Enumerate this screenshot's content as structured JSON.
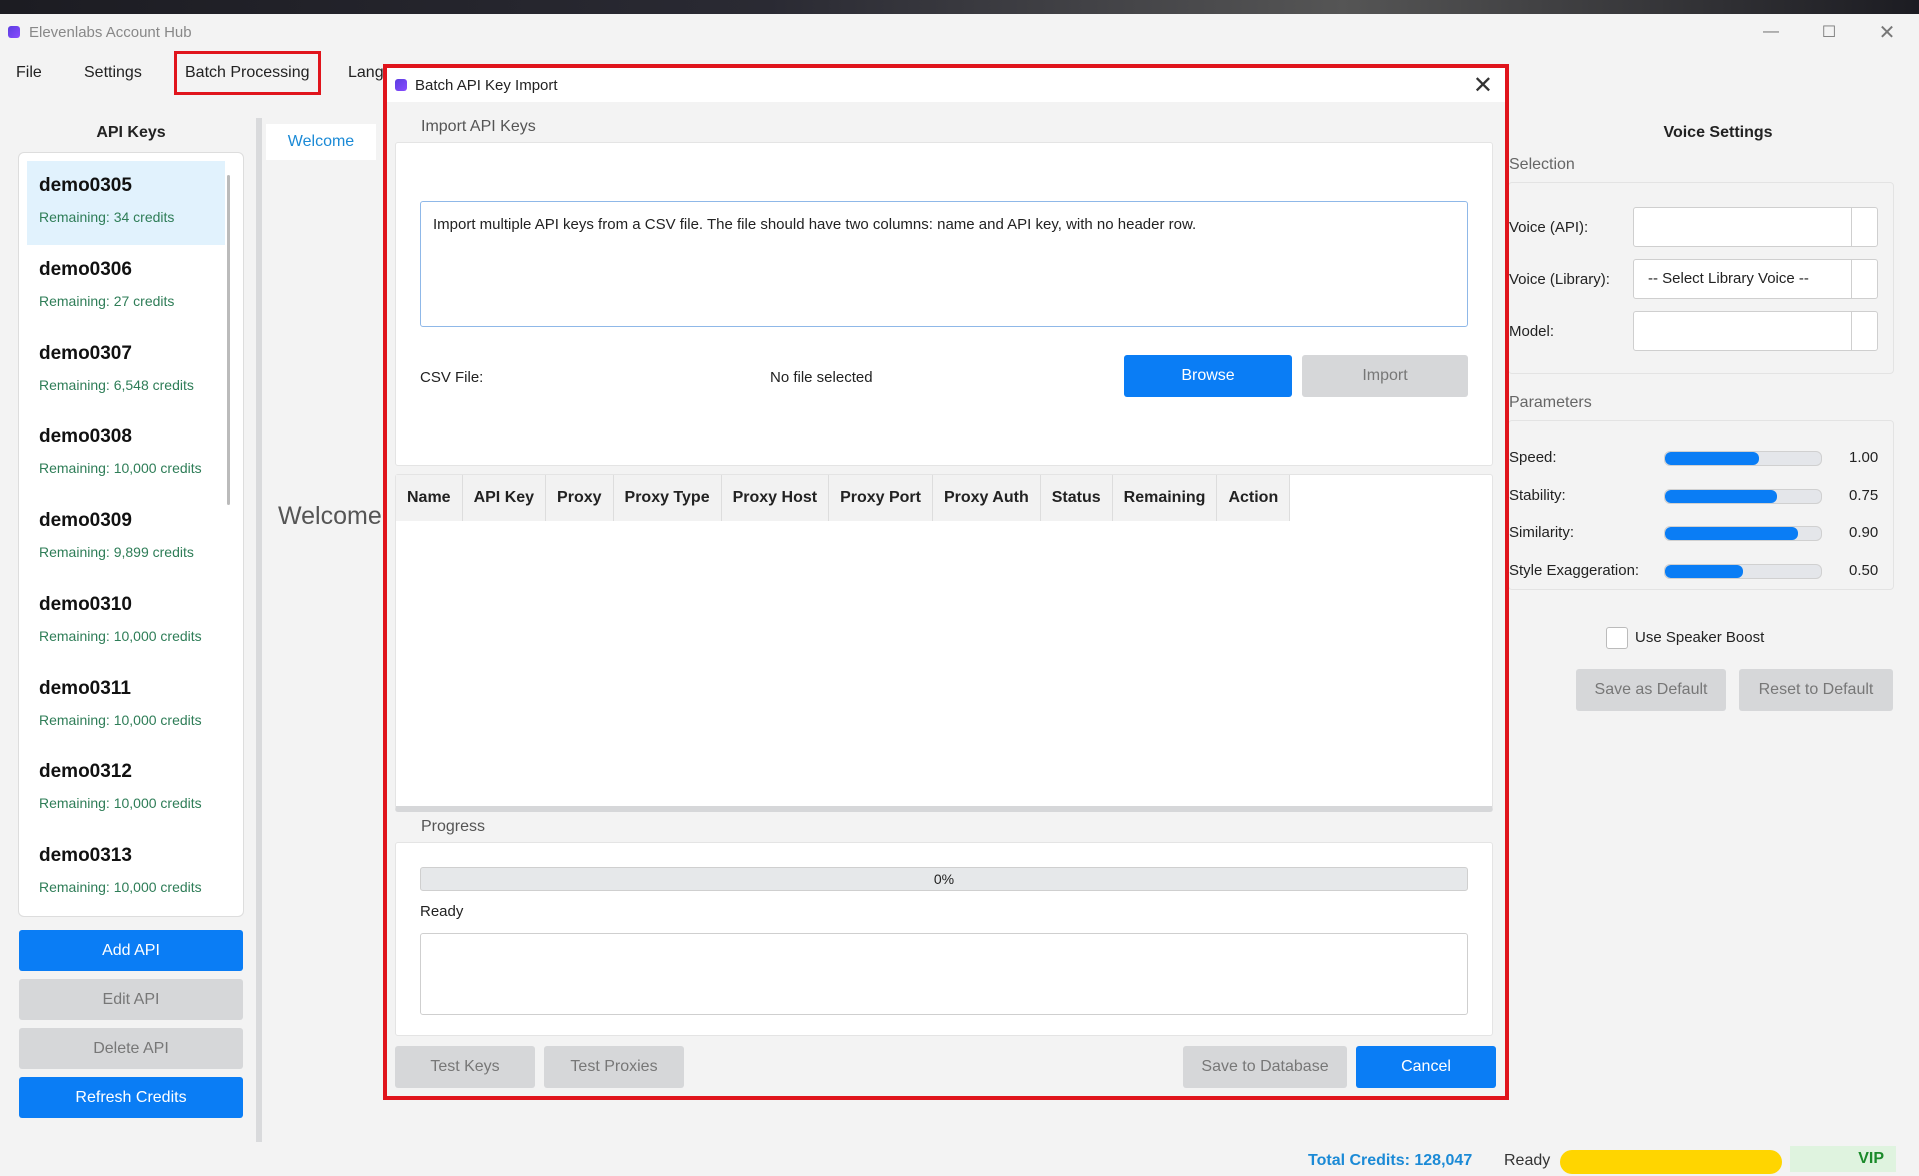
{
  "app": {
    "title": "Elevenlabs Account Hub"
  },
  "menu": {
    "file": "File",
    "settings": "Settings",
    "batch": "Batch Processing",
    "language": "Lang"
  },
  "api_keys": {
    "title": "API Keys",
    "items": [
      {
        "name": "demo0305",
        "remaining": "Remaining: 34 credits"
      },
      {
        "name": "demo0306",
        "remaining": "Remaining: 27 credits"
      },
      {
        "name": "demo0307",
        "remaining": "Remaining: 6,548 credits"
      },
      {
        "name": "demo0308",
        "remaining": "Remaining: 10,000 credits"
      },
      {
        "name": "demo0309",
        "remaining": "Remaining: 9,899 credits"
      },
      {
        "name": "demo0310",
        "remaining": "Remaining: 10,000 credits"
      },
      {
        "name": "demo0311",
        "remaining": "Remaining: 10,000 credits"
      },
      {
        "name": "demo0312",
        "remaining": "Remaining: 10,000 credits"
      },
      {
        "name": "demo0313",
        "remaining": "Remaining: 10,000 credits"
      }
    ],
    "buttons": {
      "add": "Add API",
      "edit": "Edit API",
      "delete": "Delete API",
      "refresh": "Refresh Credits"
    }
  },
  "center": {
    "tab": "Welcome",
    "heading": "Welcome"
  },
  "voice_settings": {
    "title": "Voice Settings",
    "selection_group": "Selection",
    "voice_api_label": "Voice (API):",
    "voice_library_label": "Voice (Library):",
    "voice_library_value": "-- Select Library Voice --",
    "model_label": "Model:",
    "parameters_group": "Parameters",
    "params": [
      {
        "label": "Speed:",
        "value": "1.00",
        "level": 0.6
      },
      {
        "label": "Stability:",
        "value": "0.75",
        "level": 0.72
      },
      {
        "label": "Similarity:",
        "value": "0.90",
        "level": 0.85
      },
      {
        "label": "Style Exaggeration:",
        "value": "0.50",
        "level": 0.5
      }
    ],
    "speaker_boost": "Use Speaker Boost",
    "save_default": "Save as Default",
    "reset_default": "Reset to Default"
  },
  "dialog": {
    "title": "Batch API Key Import",
    "import_tab": "Import API Keys",
    "description": "Import multiple API keys from a CSV file. The file should have two columns: name and API key, with no header row.",
    "csv_label": "CSV File:",
    "file_status": "No file selected",
    "browse": "Browse",
    "import": "Import",
    "columns": [
      "Name",
      "API Key",
      "Proxy",
      "Proxy Type",
      "Proxy Host",
      "Proxy Port",
      "Proxy Auth",
      "Status",
      "Remaining",
      "Action"
    ],
    "progress_tab": "Progress",
    "progress_text": "0%",
    "progress_value": 0,
    "status": "Ready",
    "test_keys": "Test Keys",
    "test_proxies": "Test Proxies",
    "save_db": "Save to Database",
    "cancel": "Cancel"
  },
  "statusbar": {
    "total": "Total Credits: 128,047",
    "ready": "Ready",
    "vip": "VIP"
  },
  "colors": {
    "accent": "#0a7df5",
    "highlight": "#e0141c",
    "credits": "#2e7d57",
    "redaction": "#ffd500"
  }
}
